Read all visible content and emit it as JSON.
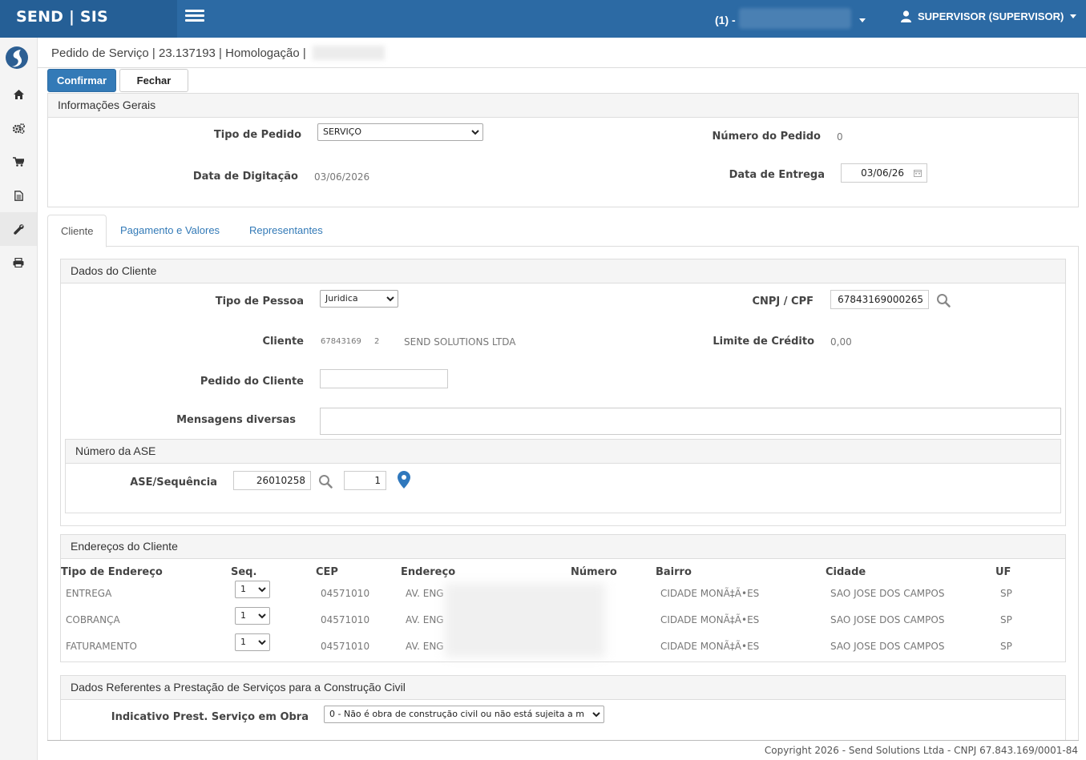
{
  "topbar": {
    "brand": "SEND | SIS",
    "company_label": "(1) -",
    "user_label": "SUPERVISOR (SUPERVISOR)"
  },
  "sidebar": {
    "items": [
      {
        "icon": "home-icon"
      },
      {
        "icon": "cogs-icon"
      },
      {
        "icon": "cart-icon"
      },
      {
        "icon": "document-icon"
      },
      {
        "icon": "wrench-icon"
      },
      {
        "icon": "print-icon"
      }
    ]
  },
  "breadcrumb": "Pedido de Serviço | 23.137193 | Homologação |",
  "actions": {
    "confirm": "Confirmar",
    "close": "Fechar"
  },
  "general": {
    "title": "Informações Gerais",
    "tipo_pedido_label": "Tipo de Pedido",
    "tipo_pedido_value": "SERVIÇO",
    "numero_pedido_label": "Número do Pedido",
    "numero_pedido_value": "0",
    "data_digitacao_label": "Data de Digitação",
    "data_digitacao_value": "03/06/2026",
    "data_entrega_label": "Data de Entrega",
    "data_entrega_value": "03/06/26"
  },
  "tabs": [
    "Cliente",
    "Pagamento e Valores",
    "Representantes"
  ],
  "cliente": {
    "title": "Dados do Cliente",
    "tipo_pessoa_label": "Tipo de Pessoa",
    "tipo_pessoa_value": "Juridica",
    "cnpj_label": "CNPJ / CPF",
    "cnpj_value": "67843169000265",
    "cliente_label": "Cliente",
    "cliente_code": "67843169",
    "cliente_seq": "2",
    "cliente_name": "SEND SOLUTIONS LTDA",
    "limite_label": "Limite de Crédito",
    "limite_value": "0,00",
    "pedido_cliente_label": "Pedido do Cliente",
    "pedido_cliente_value": "",
    "mensagens_label": "Mensagens diversas",
    "mensagens_value": ""
  },
  "ase": {
    "title": "Número da ASE",
    "label": "ASE/Sequência",
    "number": "26010258",
    "sequence": "1"
  },
  "enderecos": {
    "title": "Endereços do Cliente",
    "headers": [
      "Tipo de Endereço",
      "Seq.",
      "CEP",
      "Endereço",
      "Número",
      "Bairro",
      "Cidade",
      "UF"
    ],
    "rows": [
      {
        "tipo": "ENTREGA",
        "seq": "1",
        "cep": "04571010",
        "endereco": "AV. ENG",
        "bairro": "CIDADE MONÃ‡Ã•ES",
        "cidade": "SAO JOSE DOS CAMPOS",
        "uf": "SP"
      },
      {
        "tipo": "COBRANÇA",
        "seq": "1",
        "cep": "04571010",
        "endereco": "AV. ENG",
        "bairro": "CIDADE MONÃ‡Ã•ES",
        "cidade": "SAO JOSE DOS CAMPOS",
        "uf": "SP"
      },
      {
        "tipo": "FATURAMENTO",
        "seq": "1",
        "cep": "04571010",
        "endereco": "AV. ENG",
        "bairro": "CIDADE MONÃ‡Ã•ES",
        "cidade": "SAO JOSE DOS CAMPOS",
        "uf": "SP"
      }
    ]
  },
  "construcao": {
    "title": "Dados Referentes a Prestação de Serviços para a Construção Civil",
    "indicativo_label": "Indicativo Prest. Serviço em Obra",
    "indicativo_value": "0 - Não é obra de construção civil ou não está sujeita a m"
  },
  "footer": "Copyright 2026 - Send Solutions Ltda - CNPJ 67.843.169/0001-84",
  "colors": {
    "topbar": "#2c6aa4",
    "brand_bg": "#255f96",
    "primary": "#337ab7",
    "pin": "#2f78bd"
  }
}
